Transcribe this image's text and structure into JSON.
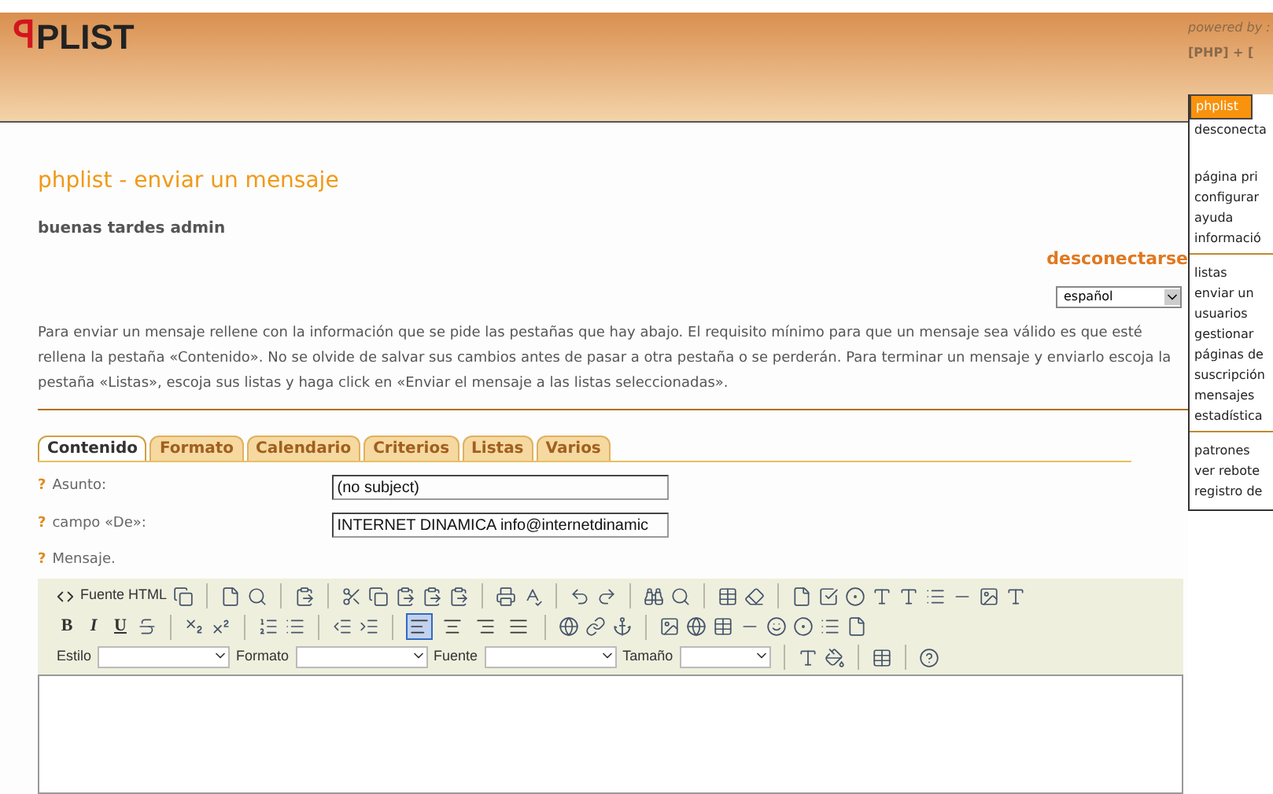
{
  "header": {
    "logo": "PLIST",
    "logo_mark": "ꟼ",
    "powered_by": "powered by :",
    "powered_tags": "[PHP] + ["
  },
  "page": {
    "title": "phplist - enviar un mensaje",
    "greeting": "buenas tardes admin",
    "logout": "desconectarse",
    "language": "español",
    "intro": "Para enviar un mensaje rellene con la información que se pide las pestañas que hay abajo. El requisito mínimo para que un mensaje sea válido es que esté rellena la pestaña «Contenido». No se olvide de salvar sus cambios antes de pasar a otra pestaña o se perderán. Para terminar un mensaje y enviarlo escoja la pestaña «Listas», escoja sus listas y haga click en «Enviar el mensaje a las listas seleccionadas»."
  },
  "tabs": [
    {
      "label": "Contenido",
      "selected": true
    },
    {
      "label": "Formato",
      "selected": false
    },
    {
      "label": "Calendario",
      "selected": false
    },
    {
      "label": "Criterios",
      "selected": false
    },
    {
      "label": "Listas",
      "selected": false
    },
    {
      "label": "Varios",
      "selected": false
    }
  ],
  "fields": [
    {
      "help": "?",
      "label": "Asunto:",
      "value": "(no subject)"
    },
    {
      "help": "?",
      "label": "campo «De»:",
      "value": "INTERNET DINAMICA info@internetdinamic"
    }
  ],
  "message": {
    "help": "?",
    "label": "Mensaje."
  },
  "editor": {
    "source_button": "Fuente HTML",
    "format_buttons": [
      "B",
      "I",
      "U"
    ],
    "align": [
      {
        "selected": true
      },
      {
        "selected": false
      },
      {
        "selected": false
      },
      {
        "selected": false
      }
    ],
    "dropdowns": [
      "Estilo",
      "Formato",
      "Fuente",
      "Tamaño"
    ]
  },
  "sidebar": {
    "title": "phplist",
    "groups": [
      [
        "desconecta"
      ],
      [
        "página pri",
        "configurar",
        "ayuda",
        "informació"
      ],
      [
        "listas",
        "enviar un",
        "usuarios",
        "gestionar",
        "páginas de",
        "suscripción",
        "mensajes",
        "estadística"
      ],
      [
        "patrones",
        "ver rebote",
        "registro de"
      ]
    ]
  }
}
